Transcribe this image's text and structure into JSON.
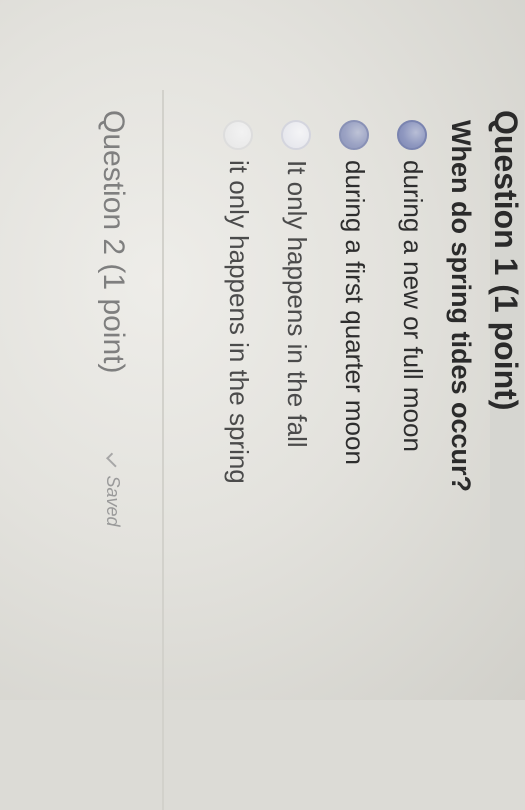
{
  "quiz": {
    "question1": {
      "title": "Question 1 (1 point)",
      "prompt": "When do spring tides occur?",
      "options": [
        {
          "label": "during a new or full moon",
          "selected": true
        },
        {
          "label": "during a first quarter moon",
          "selected": false
        },
        {
          "label": "It only happens in the fall",
          "selected": false
        },
        {
          "label": "it only happens in the spring",
          "selected": false
        }
      ]
    },
    "question2": {
      "title": "Question 2 (1 point)",
      "saved_label": "Saved"
    }
  }
}
